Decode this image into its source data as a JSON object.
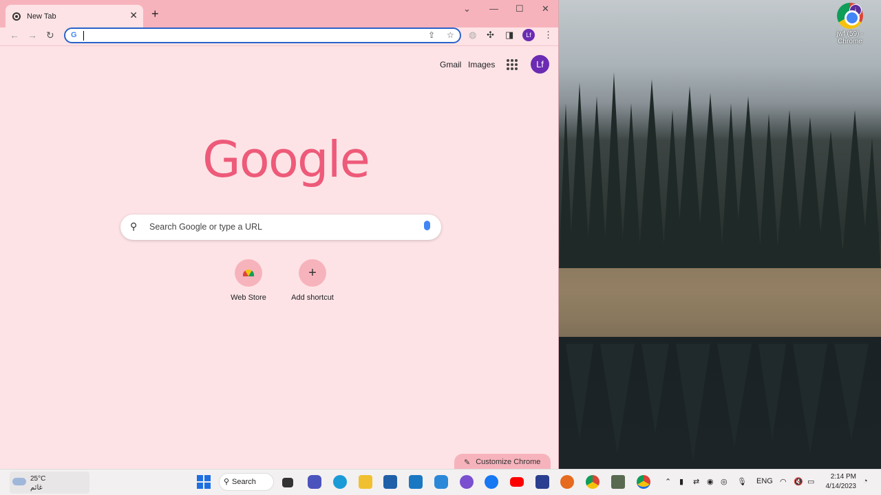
{
  "desktop": {
    "icon_label": "jwf (59) - Chrome",
    "icon_badge": "j"
  },
  "browser": {
    "tab_title": "New Tab",
    "omnibox": {
      "value": "",
      "placeholder": ""
    },
    "profile_initials": "Lf"
  },
  "ntp": {
    "gmail": "Gmail",
    "images": "Images",
    "profile_initials": "Lf",
    "logo": "Google",
    "search_placeholder": "Search Google or type a URL",
    "shortcuts": [
      {
        "label": "Web Store",
        "icon": "web-store-icon"
      },
      {
        "label": "Add shortcut",
        "icon": "plus-icon"
      }
    ],
    "customize": "Customize Chrome"
  },
  "taskbar": {
    "temperature": "25°C",
    "condition": "غائم",
    "search_label": "Search",
    "language": "ENG",
    "time": "2:14 PM",
    "date": "4/14/2023"
  },
  "colors": {
    "ntp_background": "#fde3e6",
    "titlebar": "#f7b3bc",
    "logo": "#ee5a79",
    "avatar": "#6b2bb3",
    "omnibox_focus": "#2a62c9"
  }
}
